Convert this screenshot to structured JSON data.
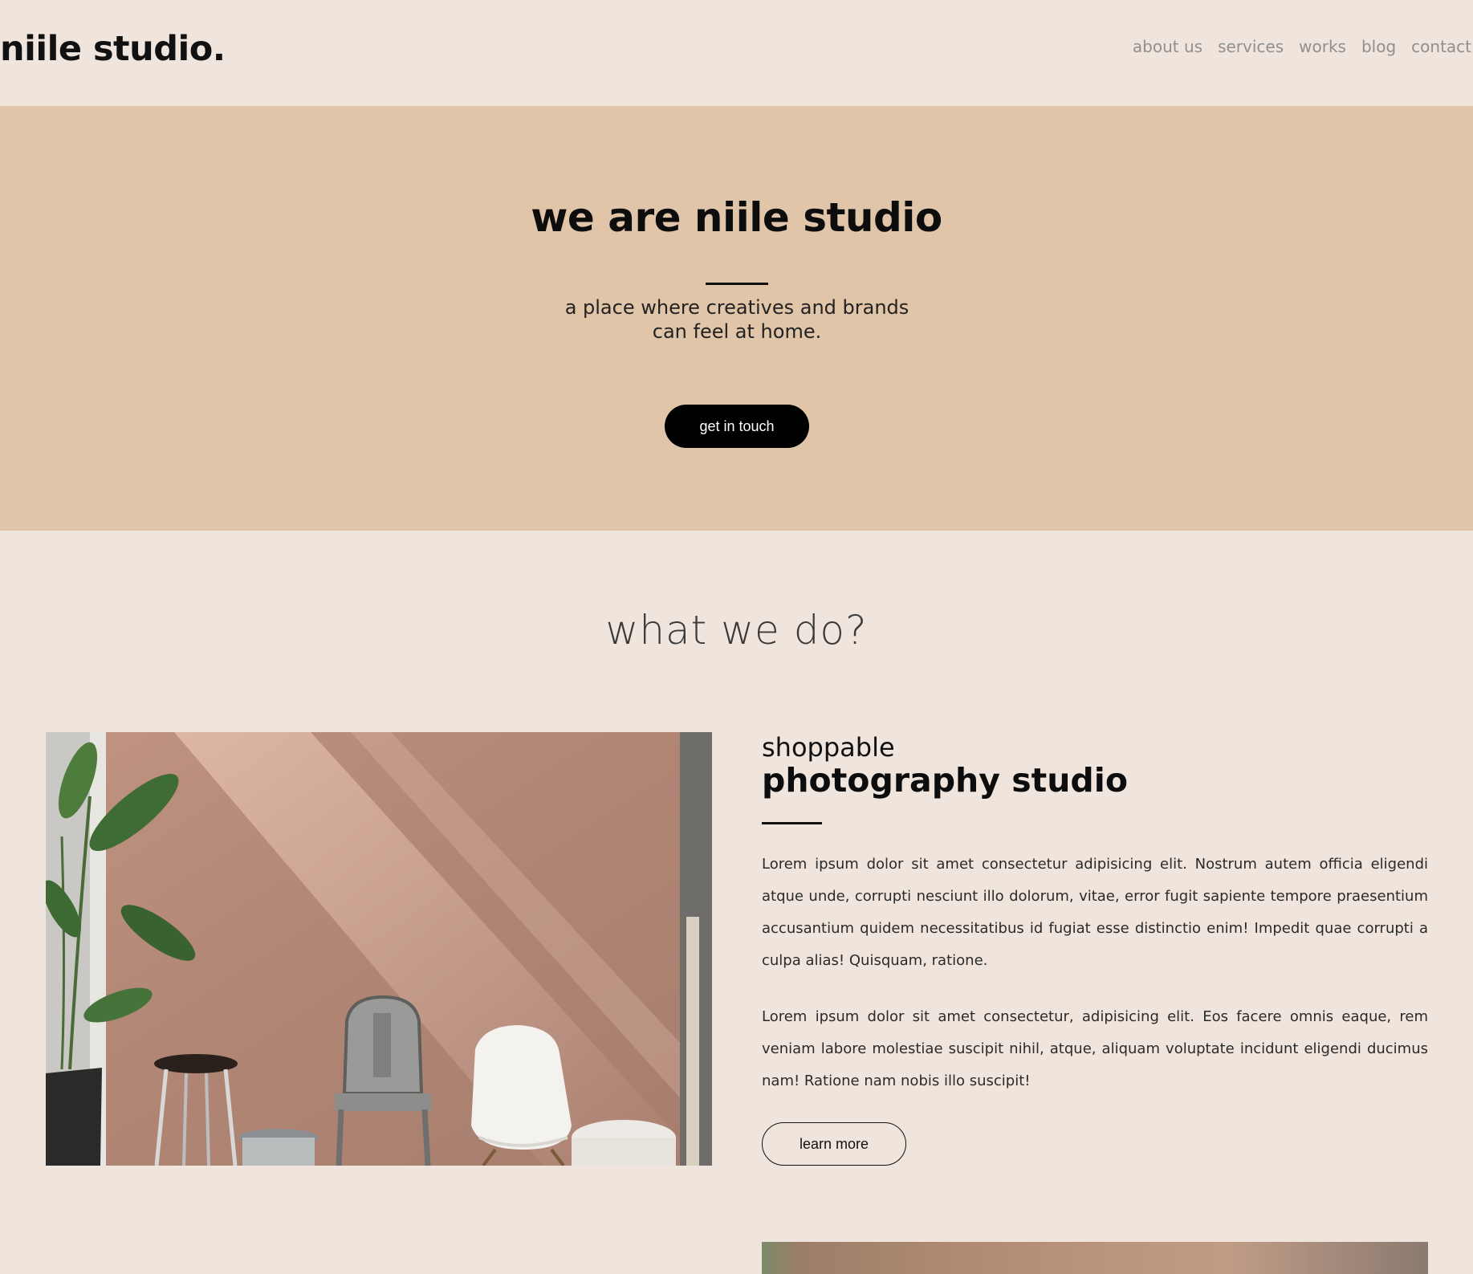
{
  "header": {
    "logo": "niile studio.",
    "nav": [
      "about us",
      "services",
      "works",
      "blog",
      "contact"
    ]
  },
  "hero": {
    "title": "we are niile studio",
    "subtitle_line1": "a place where creatives and brands",
    "subtitle_line2": "can feel at home.",
    "cta": "get in touch"
  },
  "services": {
    "section_title": "what we do?",
    "items": [
      {
        "eyebrow": "shoppable",
        "title": "photography studio",
        "paragraphs": [
          "Lorem ipsum dolor sit amet consectetur adipisicing elit. Nostrum autem officia eligendi atque unde, corrupti nesciunt illo dolorum, vitae, error fugit sapiente tempore praesentium accusantium quidem necessitatibus id fugiat esse distinctio enim! Impedit quae corrupti a culpa alias! Quisquam, ratione.",
          "Lorem ipsum dolor sit amet consectetur, adipisicing elit. Eos facere omnis eaque, rem veniam labore molestiae suscipit nihil, atque, aliquam voluptate incidunt eligendi ducimus nam! Ratione nam nobis illo suscipit!"
        ],
        "button": "learn more"
      }
    ]
  },
  "colors": {
    "page_bg": "#efe5dd",
    "hero_bg": "#e1c5a9",
    "text": "#111111",
    "nav_text": "#8f8f8f",
    "button_bg": "#000000"
  }
}
